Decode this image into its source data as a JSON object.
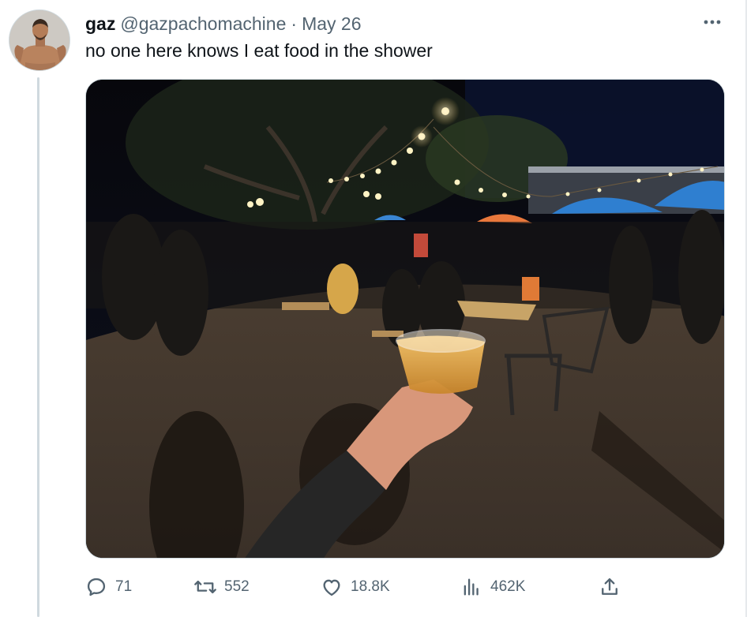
{
  "tweet": {
    "author": {
      "display_name": "gaz",
      "handle": "@gazpachomachine"
    },
    "separator": "·",
    "date": "May 26",
    "text": "no one here knows I eat food in the shower",
    "more_icon": "more-horizontal-icon"
  },
  "actions": {
    "reply": {
      "icon": "reply-icon",
      "count": "71"
    },
    "retweet": {
      "icon": "retweet-icon",
      "count": "552"
    },
    "like": {
      "icon": "heart-icon",
      "count": "18.8K"
    },
    "views": {
      "icon": "analytics-icon",
      "count": "462K"
    },
    "share": {
      "icon": "share-icon"
    }
  },
  "colors": {
    "text_primary": "#0f1419",
    "text_secondary": "#536471",
    "border": "#cfd9de"
  }
}
